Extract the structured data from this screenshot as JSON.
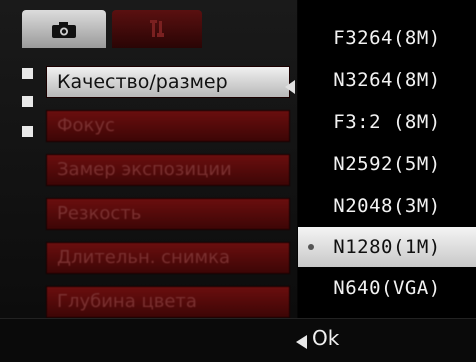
{
  "menu": {
    "items": [
      {
        "label": "Качество/размер",
        "selected": true
      },
      {
        "label": "Фокус",
        "selected": false
      },
      {
        "label": "Замер экспозиции",
        "selected": false
      },
      {
        "label": "Резкость",
        "selected": false
      },
      {
        "label": "Длительн. снимка",
        "selected": false
      },
      {
        "label": "Глубина цвета",
        "selected": false
      }
    ]
  },
  "options": {
    "items": [
      {
        "label": "F3264(8M)",
        "highlighted": false
      },
      {
        "label": "N3264(8M)",
        "highlighted": false
      },
      {
        "label": "F3:2 (8M)",
        "highlighted": false
      },
      {
        "label": "N2592(5M)",
        "highlighted": false
      },
      {
        "label": "N2048(3M)",
        "highlighted": false
      },
      {
        "label": "N1280(1M)",
        "highlighted": true
      },
      {
        "label": "N640(VGA)",
        "highlighted": false
      }
    ]
  },
  "footer": {
    "ok_label": "Ok"
  },
  "icons": {
    "tab_camera": "camera-icon",
    "tab_setup": "tools-icon",
    "back": "left-arrow-icon"
  },
  "colors": {
    "menu_bg": "#5a0a0a",
    "selected_bg": "#e0e0e0",
    "panel_bg": "#000000"
  }
}
